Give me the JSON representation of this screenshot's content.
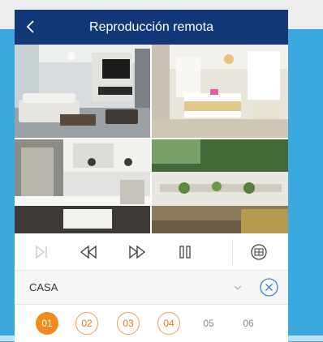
{
  "header": {
    "title": "Reproducción remota",
    "back_icon": "chevron-left-icon"
  },
  "cameras": [
    {
      "name": "camera-1-living-room"
    },
    {
      "name": "camera-2-bedroom"
    },
    {
      "name": "camera-3-kitchen"
    },
    {
      "name": "camera-4-garden"
    }
  ],
  "controls": [
    {
      "name": "step-forward-icon"
    },
    {
      "name": "rewind-icon"
    },
    {
      "name": "fast-forward-icon"
    },
    {
      "name": "pause-icon"
    },
    {
      "name": "record-icon"
    }
  ],
  "group": {
    "name": "CASA"
  },
  "channels": [
    {
      "label": "01",
      "state": "active"
    },
    {
      "label": "02",
      "state": "ring"
    },
    {
      "label": "03",
      "state": "ring"
    },
    {
      "label": "04",
      "state": "ring"
    },
    {
      "label": "05",
      "state": "plain"
    },
    {
      "label": "06",
      "state": "plain"
    }
  ],
  "colors": {
    "titlebar": "#12387a",
    "background": "#3aa9df",
    "accent": "#f28a1e"
  }
}
